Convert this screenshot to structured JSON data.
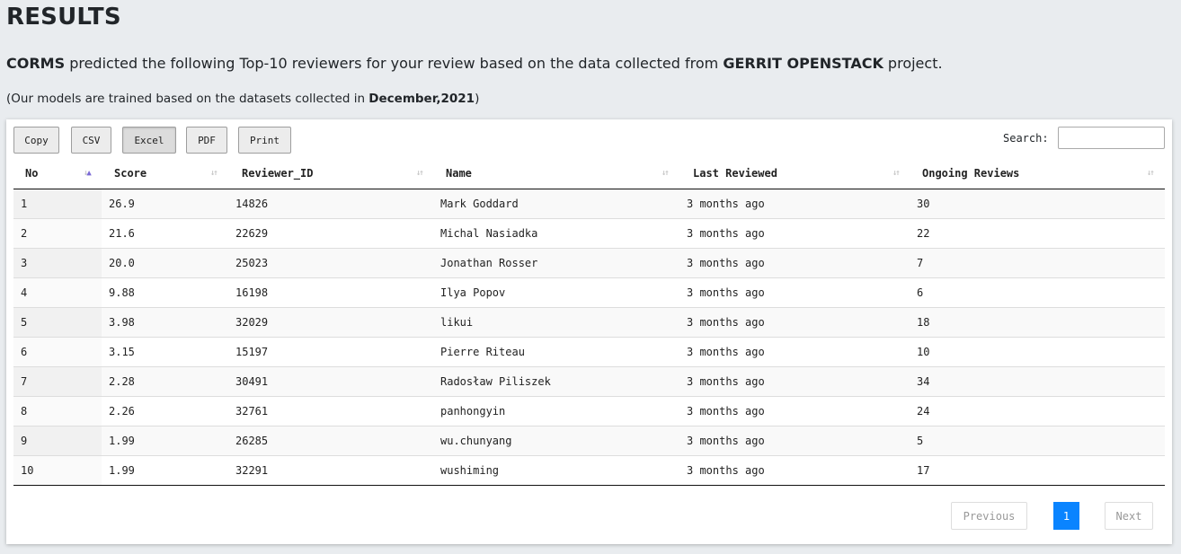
{
  "page": {
    "heading": "RESULTS",
    "intro": {
      "brand": "CORMS",
      "text_before_project": " predicted the following Top-10 reviewers for your review based on the data collected from ",
      "project": "GERRIT OPENSTACK",
      "text_after_project": " project."
    },
    "note": {
      "prefix": "(Our models are trained based on the datasets collected in ",
      "date": "December,2021",
      "suffix": ")"
    }
  },
  "toolbar": {
    "buttons": [
      "Copy",
      "CSV",
      "Excel",
      "PDF",
      "Print"
    ],
    "pressed_button": "Excel"
  },
  "search": {
    "label": "Search:",
    "value": ""
  },
  "table": {
    "sorted_column": "No",
    "sort_direction": "ascending",
    "columns": [
      "No",
      "Score",
      "Reviewer_ID",
      "Name",
      "Last Reviewed",
      "Ongoing Reviews"
    ],
    "rows": [
      [
        "1",
        "26.9",
        "14826",
        "Mark Goddard",
        "3 months ago",
        "30"
      ],
      [
        "2",
        "21.6",
        "22629",
        "Michal Nasiadka",
        "3 months ago",
        "22"
      ],
      [
        "3",
        "20.0",
        "25023",
        "Jonathan Rosser",
        "3 months ago",
        "7"
      ],
      [
        "4",
        "9.88",
        "16198",
        "Ilya Popov",
        "3 months ago",
        "6"
      ],
      [
        "5",
        "3.98",
        "32029",
        "likui",
        "3 months ago",
        "18"
      ],
      [
        "6",
        "3.15",
        "15197",
        "Pierre Riteau",
        "3 months ago",
        "10"
      ],
      [
        "7",
        "2.28",
        "30491",
        "Radosław Piliszek",
        "3 months ago",
        "34"
      ],
      [
        "8",
        "2.26",
        "32761",
        "panhongyin",
        "3 months ago",
        "24"
      ],
      [
        "9",
        "1.99",
        "26285",
        "wu.chunyang",
        "3 months ago",
        "5"
      ],
      [
        "10",
        "1.99",
        "32291",
        "wushiming",
        "3 months ago",
        "17"
      ]
    ]
  },
  "pagination": {
    "previous": "Previous",
    "current": "1",
    "next": "Next"
  },
  "colors": {
    "page_background": "#e9ecef",
    "current_page": "#0a84ff",
    "sort_active_arrow": "#7b6ad6"
  }
}
